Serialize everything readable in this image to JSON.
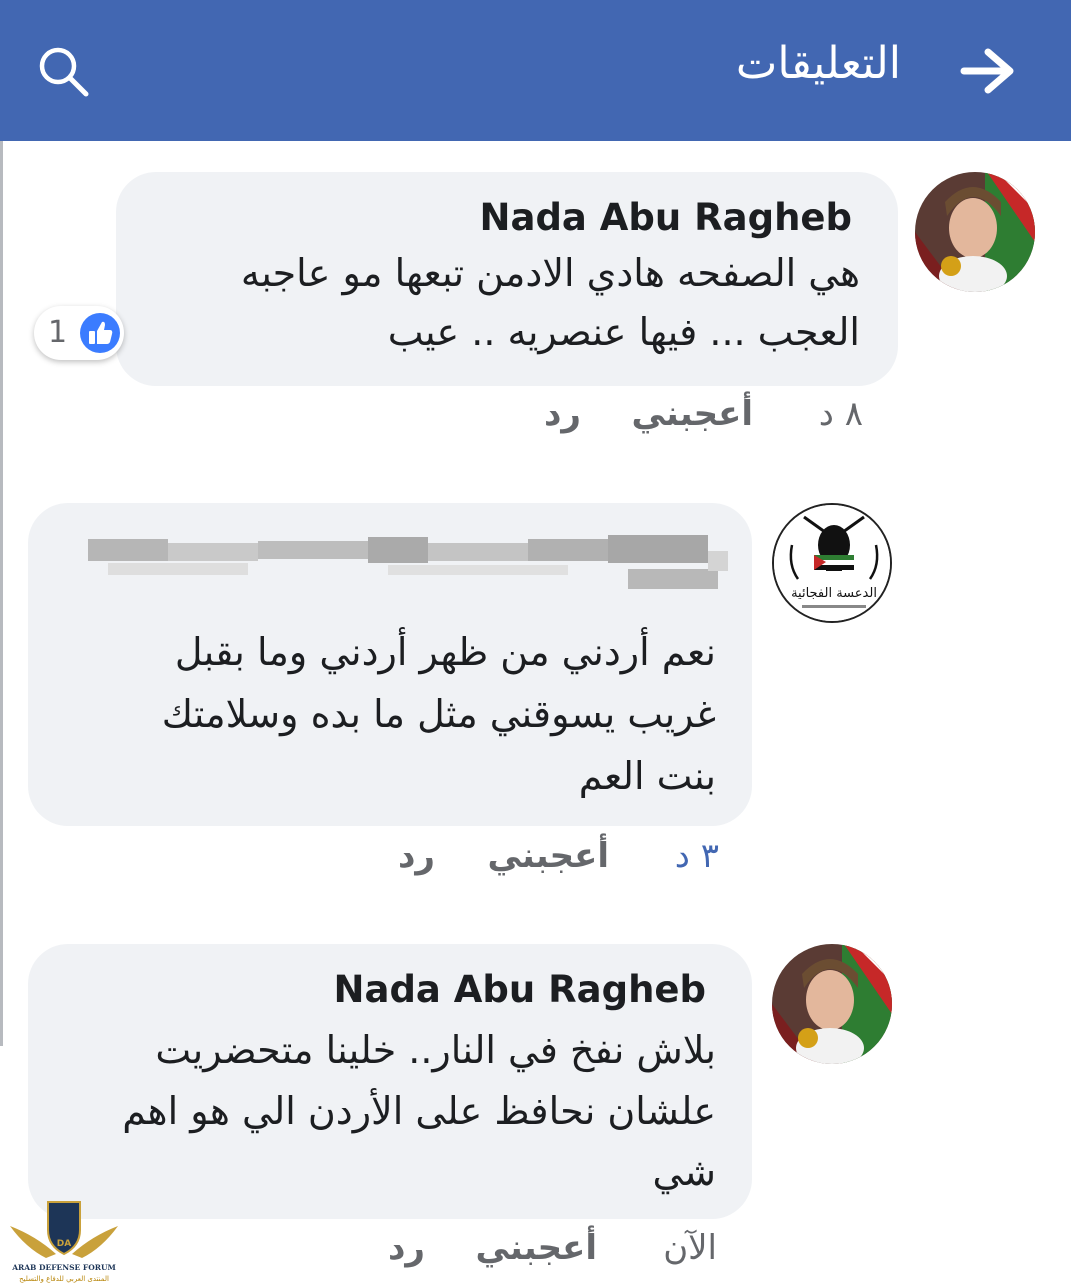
{
  "header": {
    "title": "التعليقات",
    "back_icon": "arrow-right-icon",
    "search_icon": "search-icon",
    "background": "#4267b2"
  },
  "comments": [
    {
      "author": "Nada Abu Ragheb",
      "lines": [
        "هي الصفحه هادي الادمن تبعها مو عاجبه",
        "العجب ... فيها عنصريه .. عيب"
      ],
      "reaction_count": "1",
      "time": "٨ د",
      "like_label": "أعجبني",
      "reply_label": "رد"
    },
    {
      "author_obscured": true,
      "avatar_caption": "الدعسة الفجائية",
      "lines": [
        "نعم أردني من ظهر أردني وما بقبل",
        "غريب يسوقني مثل ما بده وسلامتك",
        "بنت العم"
      ],
      "time": "٣ د",
      "like_label": "أعجبني",
      "reply_label": "رد"
    },
    {
      "author": "Nada Abu Ragheb",
      "lines": [
        "بلاش نفخ في النار.. خلينا متحضريت",
        "علشان نحافظ على الأردن الي هو اهم",
        "شي"
      ],
      "time": "الآن",
      "like_label": "أعجبني",
      "reply_label": "رد"
    }
  ],
  "watermark": {
    "logo_text": "DA",
    "name": "ARAB DEFENSE FORUM",
    "arabic_name": "المنتدى العربي للدفاع والتسليح"
  }
}
